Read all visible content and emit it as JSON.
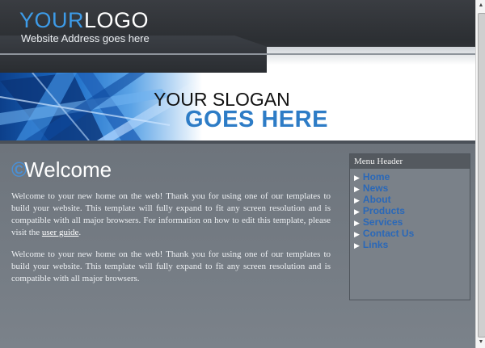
{
  "header": {
    "logo_part1": "YOUR",
    "logo_part2": "LOGO",
    "tagline": "Website Address goes here"
  },
  "banner": {
    "slogan_line1": "YOUR SLOGAN",
    "slogan_line2": "GOES HERE"
  },
  "main": {
    "heading": "Welcome",
    "heading_mark": "©",
    "paragraph1_text": "Welcome to your new home on the web! Thank you for using one of our templates to build your website. This template will fully expand to fit any screen resolution and is compatible with all major browsers. For information on how to edit this template, please visit the ",
    "paragraph1_link": "user guide",
    "paragraph1_end": ".",
    "paragraph2_text": "Welcome to your new home on the web! Thank you for using one of our templates to build your website. This template will fully expand to fit any screen resolution and is compatible with all major browsers."
  },
  "sidebar": {
    "header": "Menu Header",
    "items": [
      {
        "label": "Home"
      },
      {
        "label": "News"
      },
      {
        "label": "About"
      },
      {
        "label": "Products"
      },
      {
        "label": "Services"
      },
      {
        "label": "Contact Us"
      },
      {
        "label": "Links"
      }
    ]
  },
  "colors": {
    "accent_blue": "#2d7cc6",
    "menu_link": "#2a68b8",
    "content_bg": "#7a818a",
    "header_dark": "#2c2f33"
  },
  "icons": {
    "menu_arrow": "triangle-right-icon",
    "scroll_up": "arrow-up-icon",
    "scroll_down": "arrow-down-icon"
  }
}
